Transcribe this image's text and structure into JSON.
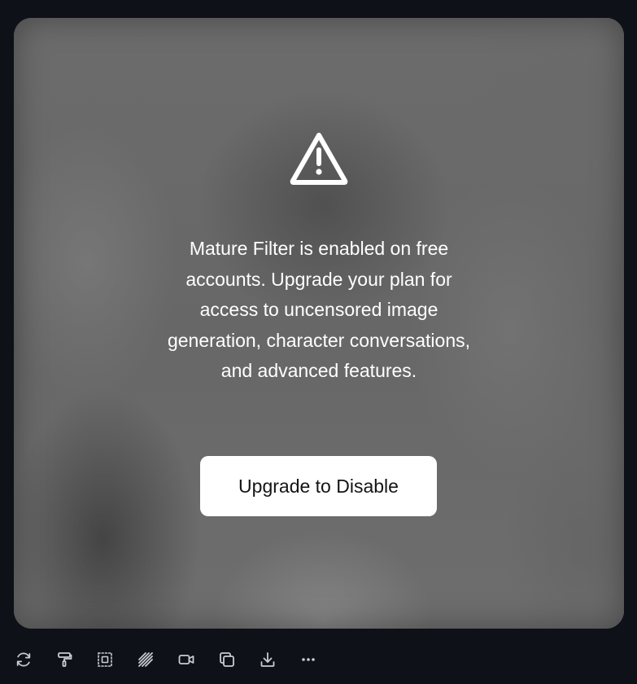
{
  "notice": {
    "icon": "warning-triangle-icon",
    "message": "Mature Filter is enabled on free accounts. Upgrade your plan for access to uncensored image generation, character conversations, and advanced features.",
    "button_label": "Upgrade to Disable"
  },
  "toolbar": {
    "tools": [
      {
        "icon": "refresh-icon"
      },
      {
        "icon": "paint-roller-icon"
      },
      {
        "icon": "select-frame-icon"
      },
      {
        "icon": "hatch-pattern-icon"
      },
      {
        "icon": "video-camera-icon"
      },
      {
        "icon": "copy-icon"
      },
      {
        "icon": "download-icon"
      },
      {
        "icon": "more-options-icon"
      }
    ]
  },
  "colors": {
    "page_background": "#0e1117",
    "card_background": "#6a6a6a",
    "icon_color": "#c9ccd3",
    "button_background": "#ffffff",
    "text_color": "#ffffff"
  }
}
